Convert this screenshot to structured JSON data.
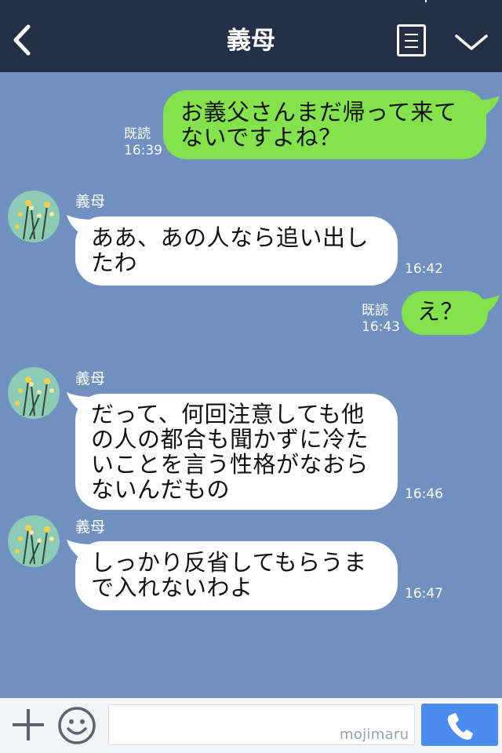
{
  "header": {
    "title": "義母",
    "back_icon": "chevron-left-icon",
    "menu_icon": "menu-list-icon",
    "collapse_icon": "chevron-down-icon"
  },
  "contact": {
    "name": "義母",
    "avatar_icon": "flower-avatar"
  },
  "messages": [
    {
      "side": "out",
      "lines": [
        "お義父さんまだ帰って来て",
        "ないですよね？"
      ],
      "read": "既読",
      "time": "16:39"
    },
    {
      "side": "in",
      "sender": "義母",
      "lines": [
        "ああ、あの人なら追い出し",
        "たわ"
      ],
      "time": "16:42"
    },
    {
      "side": "out",
      "lines": [
        "え？"
      ],
      "read": "既読",
      "time": "16:43"
    },
    {
      "side": "in",
      "sender": "義母",
      "lines": [
        "だって、何回注意しても他",
        "の人の都合も聞かずに冷た",
        "いことを言う性格がなおら",
        "ないんだもの"
      ],
      "time": "16:46"
    },
    {
      "side": "in",
      "sender": "義母",
      "lines": [
        "しっかり反省してもらうま",
        "で入れないわよ"
      ],
      "time": "16:47"
    }
  ],
  "input_bar": {
    "plus_icon": "plus-icon",
    "sticker_icon": "smiley-icon",
    "input_value": "",
    "watermark": "mojimaru",
    "call_icon": "phone-icon"
  },
  "colors": {
    "header_bg": "#252f45",
    "chat_bg": "#7090c0",
    "outgoing_bubble": "#84e34c",
    "incoming_bubble": "#ffffff",
    "call_button": "#4b8cf0"
  }
}
